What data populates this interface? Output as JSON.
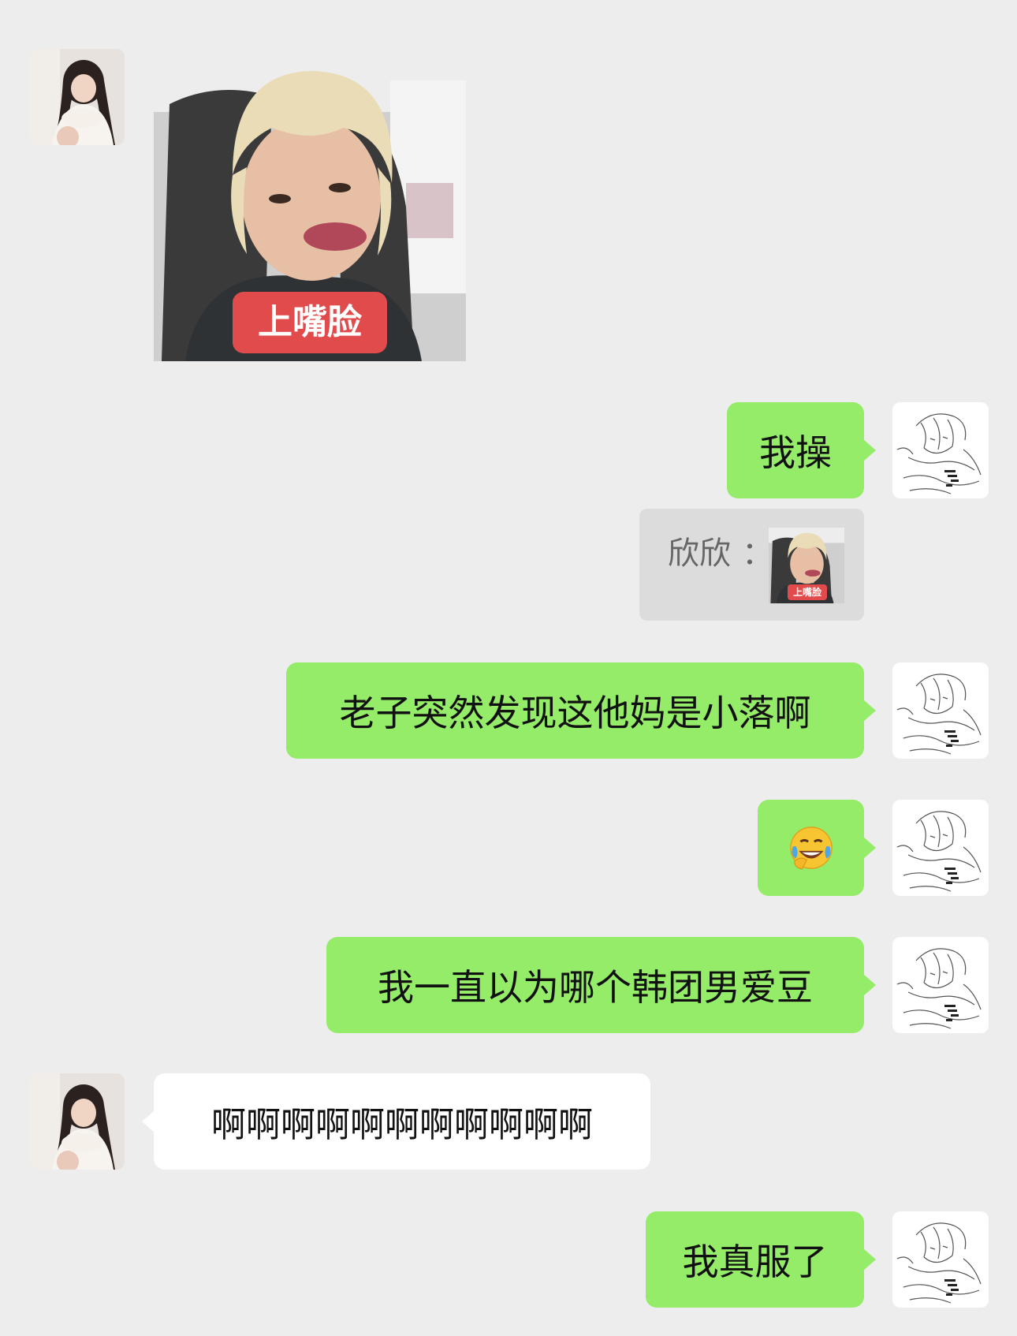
{
  "messages": [
    {
      "side": "left",
      "type": "sticker",
      "sticker_label": "上嘴脸"
    },
    {
      "side": "right",
      "type": "text",
      "text": "我操"
    },
    {
      "side": "right",
      "type": "quote",
      "quote_author": "欣欣",
      "quote_sep": "：",
      "quote_sticker_label": "上嘴脸"
    },
    {
      "side": "right",
      "type": "text",
      "text": "老子突然发现这他妈是小落啊"
    },
    {
      "side": "right",
      "type": "emoji",
      "text": "😂",
      "emoji_name": "laughing-tears-face-icon"
    },
    {
      "side": "right",
      "type": "text",
      "text": "我一直以为哪个韩团男爱豆"
    },
    {
      "side": "left",
      "type": "text",
      "text": "啊啊啊啊啊啊啊啊啊啊啊"
    },
    {
      "side": "right",
      "type": "text",
      "text": "我真服了"
    }
  ],
  "colors": {
    "background": "#ededed",
    "sent_bubble": "#95ec69",
    "received_bubble": "#ffffff",
    "quote_bg": "#dcdcdc",
    "sticker_label_bg": "#e24b4b"
  }
}
